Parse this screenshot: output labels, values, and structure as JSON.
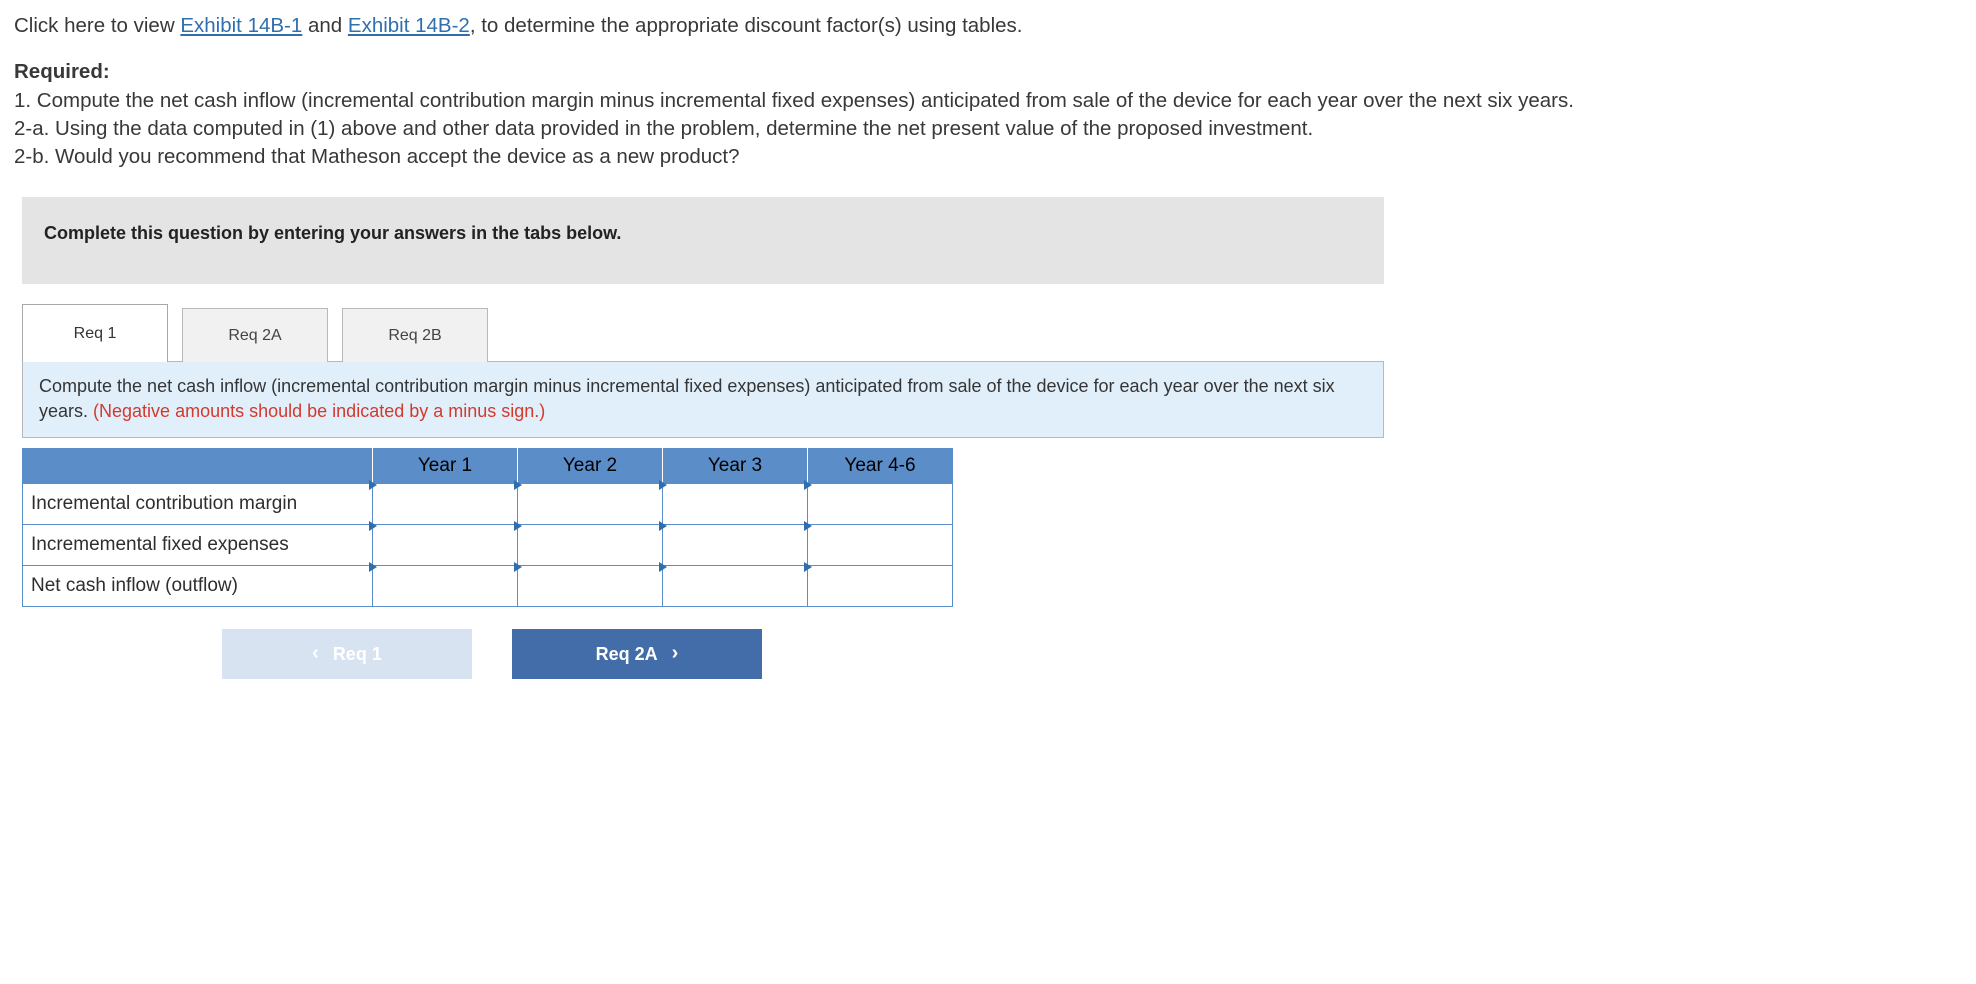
{
  "intro": {
    "pre": "Click here to view ",
    "link1": "Exhibit 14B-1",
    "mid": " and ",
    "link2": "Exhibit 14B-2",
    "post": ", to determine the appropriate discount factor(s) using tables."
  },
  "required": {
    "heading": "Required:",
    "item1": "1. Compute the net cash inflow (incremental contribution margin minus incremental fixed expenses) anticipated from sale of the device for each year over the next six years.",
    "item2a": "2-a. Using the data computed in (1) above and other data provided in the problem, determine the net present value of the proposed investment.",
    "item2b": "2-b. Would you recommend that Matheson accept the device as a new product?"
  },
  "instruction_bar": "Complete this question by entering your answers in the tabs below.",
  "tabs": {
    "t1": "Req 1",
    "t2": "Req 2A",
    "t3": "Req 2B"
  },
  "prompt": {
    "main": "Compute the net cash inflow (incremental contribution margin minus incremental fixed expenses) anticipated from sale of the device for each year over the next six years. ",
    "note": "(Negative amounts should be indicated by a minus sign.)"
  },
  "table": {
    "headers": {
      "h0": "",
      "h1": "Year 1",
      "h2": "Year 2",
      "h3": "Year 3",
      "h4": "Year 4-6"
    },
    "rows": [
      {
        "label": "Incremental contribution margin",
        "v1": "",
        "v2": "",
        "v3": "",
        "v4": ""
      },
      {
        "label": "Incrememental fixed expenses",
        "v1": "",
        "v2": "",
        "v3": "",
        "v4": ""
      },
      {
        "label": "Net cash inflow  (outflow)",
        "v1": "",
        "v2": "",
        "v3": "",
        "v4": ""
      }
    ]
  },
  "nav": {
    "prev_label": "Req 1",
    "next_label": "Req 2A"
  }
}
